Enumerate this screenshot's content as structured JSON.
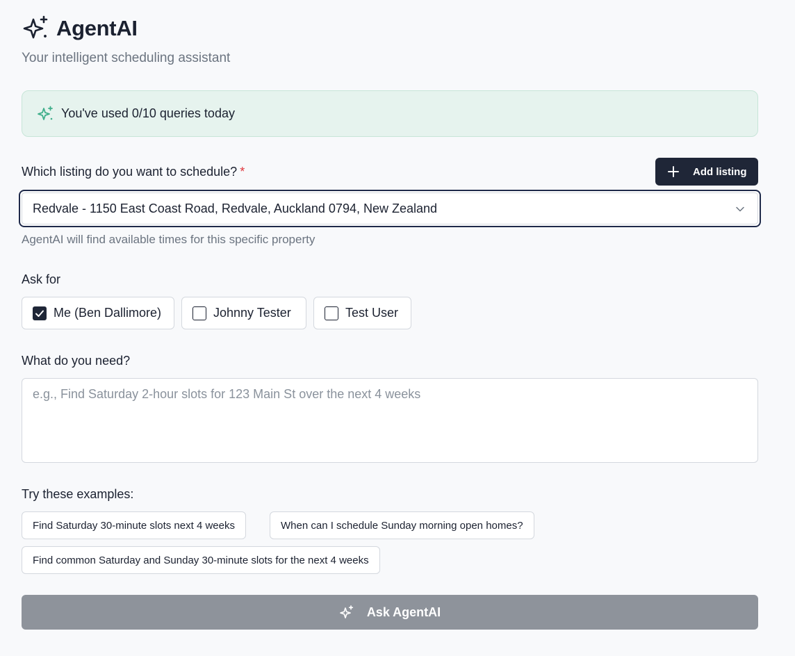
{
  "app": {
    "title": "AgentAI",
    "subtitle": "Your intelligent scheduling assistant",
    "logo_icon": "sparkles-icon"
  },
  "usage": {
    "text": "You've used 0/10 queries today",
    "icon": "sparkles-icon",
    "used": 0,
    "limit": 10
  },
  "listing": {
    "label": "Which listing do you want to schedule?",
    "required_marker": "*",
    "selected": "Redvale - 1150 East Coast Road, Redvale, Auckland 0794, New Zealand",
    "helper": "AgentAI will find available times for this specific property",
    "add_button_label": "Add listing"
  },
  "ask_for": {
    "label": "Ask for",
    "people": [
      {
        "name": "Me (Ben Dallimore)",
        "checked": true
      },
      {
        "name": "Johnny Tester",
        "checked": false
      },
      {
        "name": "Test User",
        "checked": false
      }
    ]
  },
  "need": {
    "label": "What do you need?",
    "placeholder": "e.g., Find Saturday 2-hour slots for 123 Main St over the next 4 weeks",
    "value": ""
  },
  "examples": {
    "label": "Try these examples:",
    "items": [
      "Find Saturday 30-minute slots next 4 weeks",
      "When can I schedule Sunday morning open homes?",
      "Find common Saturday and Sunday 30-minute slots for the next 4 weeks"
    ]
  },
  "submit": {
    "label": "Ask AgentAI",
    "disabled": true
  },
  "colors": {
    "primary_dark": "#1f2637",
    "usage_bg": "#e6f3ee",
    "usage_accent": "#3fae8a",
    "required": "#e0383e",
    "submit_disabled": "#8e939b",
    "page_bg": "#f8f9fb"
  }
}
